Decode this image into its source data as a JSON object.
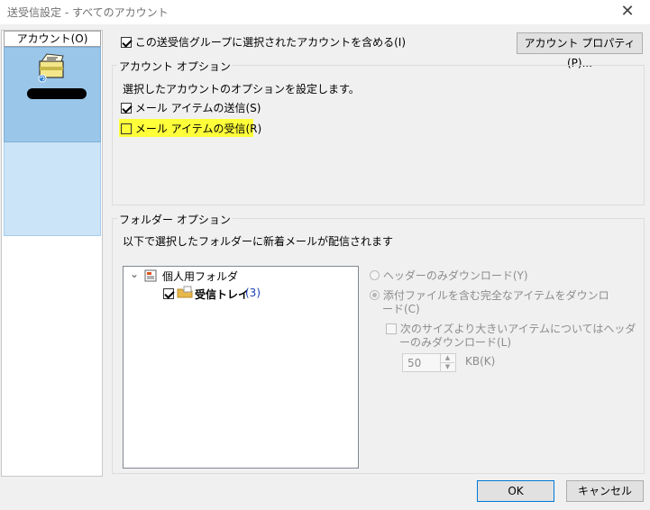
{
  "window": {
    "title": "送受信設定 - すべてのアカウント",
    "close_glyph": "✕"
  },
  "left_pane": {
    "header": "アカウント(O)"
  },
  "include_accounts": {
    "label": "この送受信グループに選択されたアカウントを含める(I)",
    "checked": true
  },
  "account_properties_button": "アカウント プロパティ(P)...",
  "account_options": {
    "legend": "アカウント オプション",
    "description": "選択したアカウントのオプションを設定します。",
    "send_mail": {
      "label": "メール アイテムの送信(S)",
      "checked": true
    },
    "receive_mail": {
      "label": "メール アイテムの受信(R)",
      "checked": false,
      "highlight_color": "#ffff3a"
    }
  },
  "folder_options": {
    "legend": "フォルダー オプション",
    "description": "以下で選択したフォルダーに新着メールが配信されます",
    "tree": {
      "root": {
        "label": "個人用フォルダ",
        "expand_glyph": "⌄"
      },
      "child": {
        "label": "受信トレイ",
        "count": "(3)",
        "checked": true
      }
    },
    "headers_only": {
      "label": "ヘッダーのみダウンロード(Y)"
    },
    "full_items": {
      "label_line1": "添付ファイルを含む完全なアイテムをダウンロ",
      "label_line2": "ード(C)"
    },
    "size_limit": {
      "label_line1": "次のサイズより大きいアイテムについてはヘッダ",
      "label_line2": "ーのみダウンロード(L)"
    },
    "size_value": "50",
    "size_unit": "KB(K)"
  },
  "footer": {
    "ok": "OK",
    "cancel": "キャンセル"
  },
  "colors": {
    "selection": "#99c6e9",
    "list_bg": "#cce4f7",
    "accent": "#0078d7"
  }
}
